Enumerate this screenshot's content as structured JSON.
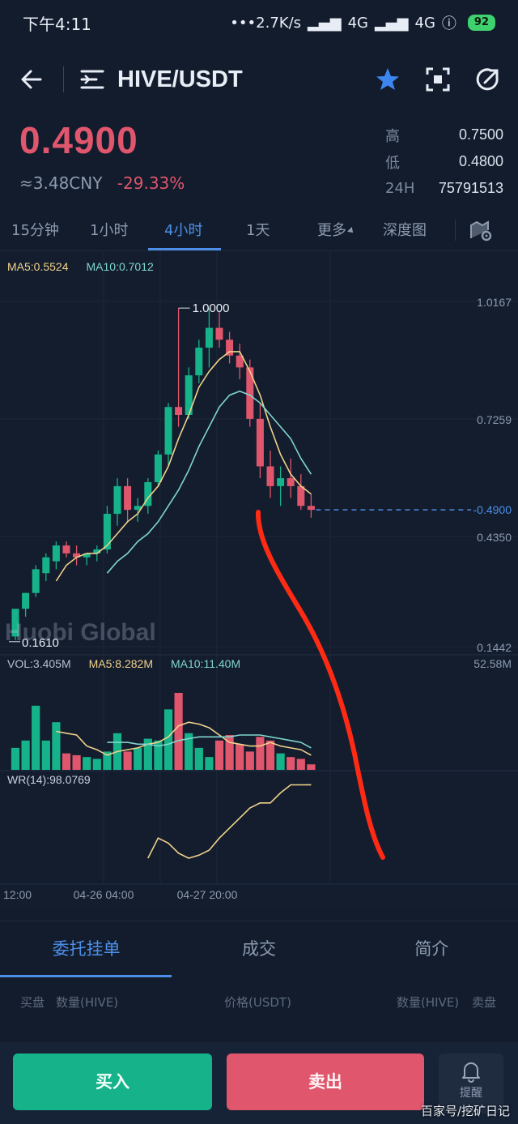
{
  "status_bar": {
    "time": "下午4:11",
    "network_speed": "•••2.7K/s",
    "signal1": "4G",
    "signal2": "4G",
    "battery": "92"
  },
  "header": {
    "pair": "HIVE/USDT"
  },
  "ticker": {
    "last_price": "0.4900",
    "cny_price": "≈3.48CNY",
    "change": "-29.33%",
    "high_label": "高",
    "high": "0.7500",
    "low_label": "低",
    "low": "0.4800",
    "volume_label": "24H",
    "volume": "75791513"
  },
  "interval_tabs": [
    {
      "label": "15分钟"
    },
    {
      "label": "1小时"
    },
    {
      "label": "4小时"
    },
    {
      "label": "1天"
    },
    {
      "label": "更多"
    },
    {
      "label": "深度图"
    }
  ],
  "indicators": {
    "ma5": "MA5:0.5524",
    "ma10": "MA10:0.7012",
    "vol": "VOL:3.405M",
    "vol_ma5": "MA5:8.282M",
    "vol_ma10": "MA10:11.40M",
    "wr": "WR(14):98.0769"
  },
  "watermark": "Huobi Global",
  "colors": {
    "up": "#16b38a",
    "down": "#e0566c",
    "accent": "#4d8fe8",
    "ma5": "#f1d28a",
    "ma10": "#7fd6cc",
    "annotation": "#ff2a14"
  },
  "chart_data": {
    "type": "candlestick",
    "y_ticks": [
      "1.0167",
      "0.7259",
      "0.4350",
      "0.1442"
    ],
    "current_price_label": "0.4900",
    "high_label": "1.0000",
    "low_label": "0.1610",
    "vol_max_label": "52.58M",
    "x_labels": [
      "12:00",
      "04-26 04:00",
      "04-27 20:00"
    ],
    "ylim": [
      0.1442,
      1.0167
    ],
    "candles": [
      {
        "o": 0.17,
        "h": 0.19,
        "l": 0.161,
        "c": 0.24
      },
      {
        "o": 0.24,
        "h": 0.28,
        "l": 0.22,
        "c": 0.28
      },
      {
        "o": 0.28,
        "h": 0.35,
        "l": 0.27,
        "c": 0.34
      },
      {
        "o": 0.33,
        "h": 0.38,
        "l": 0.31,
        "c": 0.37
      },
      {
        "o": 0.36,
        "h": 0.41,
        "l": 0.34,
        "c": 0.4
      },
      {
        "o": 0.4,
        "h": 0.41,
        "l": 0.37,
        "c": 0.38
      },
      {
        "o": 0.38,
        "h": 0.4,
        "l": 0.35,
        "c": 0.37
      },
      {
        "o": 0.37,
        "h": 0.38,
        "l": 0.35,
        "c": 0.38
      },
      {
        "o": 0.38,
        "h": 0.4,
        "l": 0.36,
        "c": 0.39
      },
      {
        "o": 0.39,
        "h": 0.5,
        "l": 0.38,
        "c": 0.48
      },
      {
        "o": 0.48,
        "h": 0.57,
        "l": 0.45,
        "c": 0.55
      },
      {
        "o": 0.55,
        "h": 0.57,
        "l": 0.46,
        "c": 0.49
      },
      {
        "o": 0.49,
        "h": 0.52,
        "l": 0.46,
        "c": 0.5
      },
      {
        "o": 0.5,
        "h": 0.57,
        "l": 0.48,
        "c": 0.56
      },
      {
        "o": 0.56,
        "h": 0.64,
        "l": 0.55,
        "c": 0.63
      },
      {
        "o": 0.63,
        "h": 0.76,
        "l": 0.6,
        "c": 0.75
      },
      {
        "o": 0.75,
        "h": 1.0,
        "l": 0.7,
        "c": 0.73
      },
      {
        "o": 0.73,
        "h": 0.85,
        "l": 0.72,
        "c": 0.83
      },
      {
        "o": 0.83,
        "h": 0.92,
        "l": 0.81,
        "c": 0.9
      },
      {
        "o": 0.9,
        "h": 1.0,
        "l": 0.85,
        "c": 0.95
      },
      {
        "o": 0.95,
        "h": 0.99,
        "l": 0.9,
        "c": 0.92
      },
      {
        "o": 0.92,
        "h": 0.94,
        "l": 0.86,
        "c": 0.88
      },
      {
        "o": 0.88,
        "h": 0.91,
        "l": 0.82,
        "c": 0.85
      },
      {
        "o": 0.85,
        "h": 0.87,
        "l": 0.7,
        "c": 0.72
      },
      {
        "o": 0.72,
        "h": 0.76,
        "l": 0.57,
        "c": 0.6
      },
      {
        "o": 0.6,
        "h": 0.64,
        "l": 0.52,
        "c": 0.55
      },
      {
        "o": 0.55,
        "h": 0.6,
        "l": 0.5,
        "c": 0.57
      },
      {
        "o": 0.57,
        "h": 0.62,
        "l": 0.52,
        "c": 0.55
      },
      {
        "o": 0.55,
        "h": 0.58,
        "l": 0.49,
        "c": 0.5
      },
      {
        "o": 0.5,
        "h": 0.53,
        "l": 0.47,
        "c": 0.49
      }
    ],
    "ma5": [
      null,
      null,
      null,
      null,
      0.31,
      0.35,
      0.37,
      0.38,
      0.38,
      0.4,
      0.43,
      0.46,
      0.48,
      0.52,
      0.55,
      0.6,
      0.67,
      0.73,
      0.8,
      0.84,
      0.87,
      0.89,
      0.89,
      0.84,
      0.78,
      0.7,
      0.63,
      0.58,
      0.55,
      0.53
    ],
    "ma10": [
      null,
      null,
      null,
      null,
      null,
      null,
      null,
      null,
      null,
      0.33,
      0.36,
      0.38,
      0.41,
      0.43,
      0.46,
      0.5,
      0.54,
      0.59,
      0.65,
      0.7,
      0.75,
      0.78,
      0.79,
      0.78,
      0.76,
      0.73,
      0.7,
      0.67,
      0.62,
      0.58
    ],
    "volume": [
      12,
      16,
      35,
      16,
      26,
      9,
      8,
      7,
      6,
      10,
      20,
      10,
      12,
      17,
      16,
      33,
      42,
      20,
      12,
      7,
      16,
      19,
      14,
      10,
      18,
      16,
      9,
      7,
      6,
      3
    ],
    "vol_ma5": [
      null,
      null,
      null,
      null,
      21,
      20,
      19,
      13,
      11,
      8,
      10,
      11,
      12,
      14,
      15,
      18,
      24,
      26,
      25,
      23,
      19,
      15,
      14,
      13,
      13,
      15,
      13,
      12,
      11,
      8
    ],
    "vol_ma10": [
      null,
      null,
      null,
      null,
      null,
      null,
      null,
      null,
      null,
      15,
      15,
      15,
      14,
      14,
      13,
      14,
      16,
      17,
      18,
      18,
      18,
      18,
      19,
      19,
      19,
      18,
      17,
      16,
      15,
      12
    ],
    "wr": [
      null,
      null,
      null,
      null,
      null,
      null,
      null,
      null,
      null,
      null,
      null,
      null,
      null,
      25,
      45,
      40,
      30,
      25,
      28,
      33,
      45,
      55,
      65,
      75,
      80,
      80,
      90,
      98,
      98,
      98.08
    ]
  },
  "order_tabs": [
    {
      "label": "委托挂单"
    },
    {
      "label": "成交"
    },
    {
      "label": "简介"
    }
  ],
  "book_headers": {
    "bid": "买盘",
    "bid_qty": "数量(HIVE)",
    "price": "价格(USDT)",
    "ask_qty": "数量(HIVE)",
    "ask": "卖盘"
  },
  "actions": {
    "buy": "买入",
    "sell": "卖出",
    "remind": "提醒"
  },
  "credit": "百家号/挖矿日记"
}
